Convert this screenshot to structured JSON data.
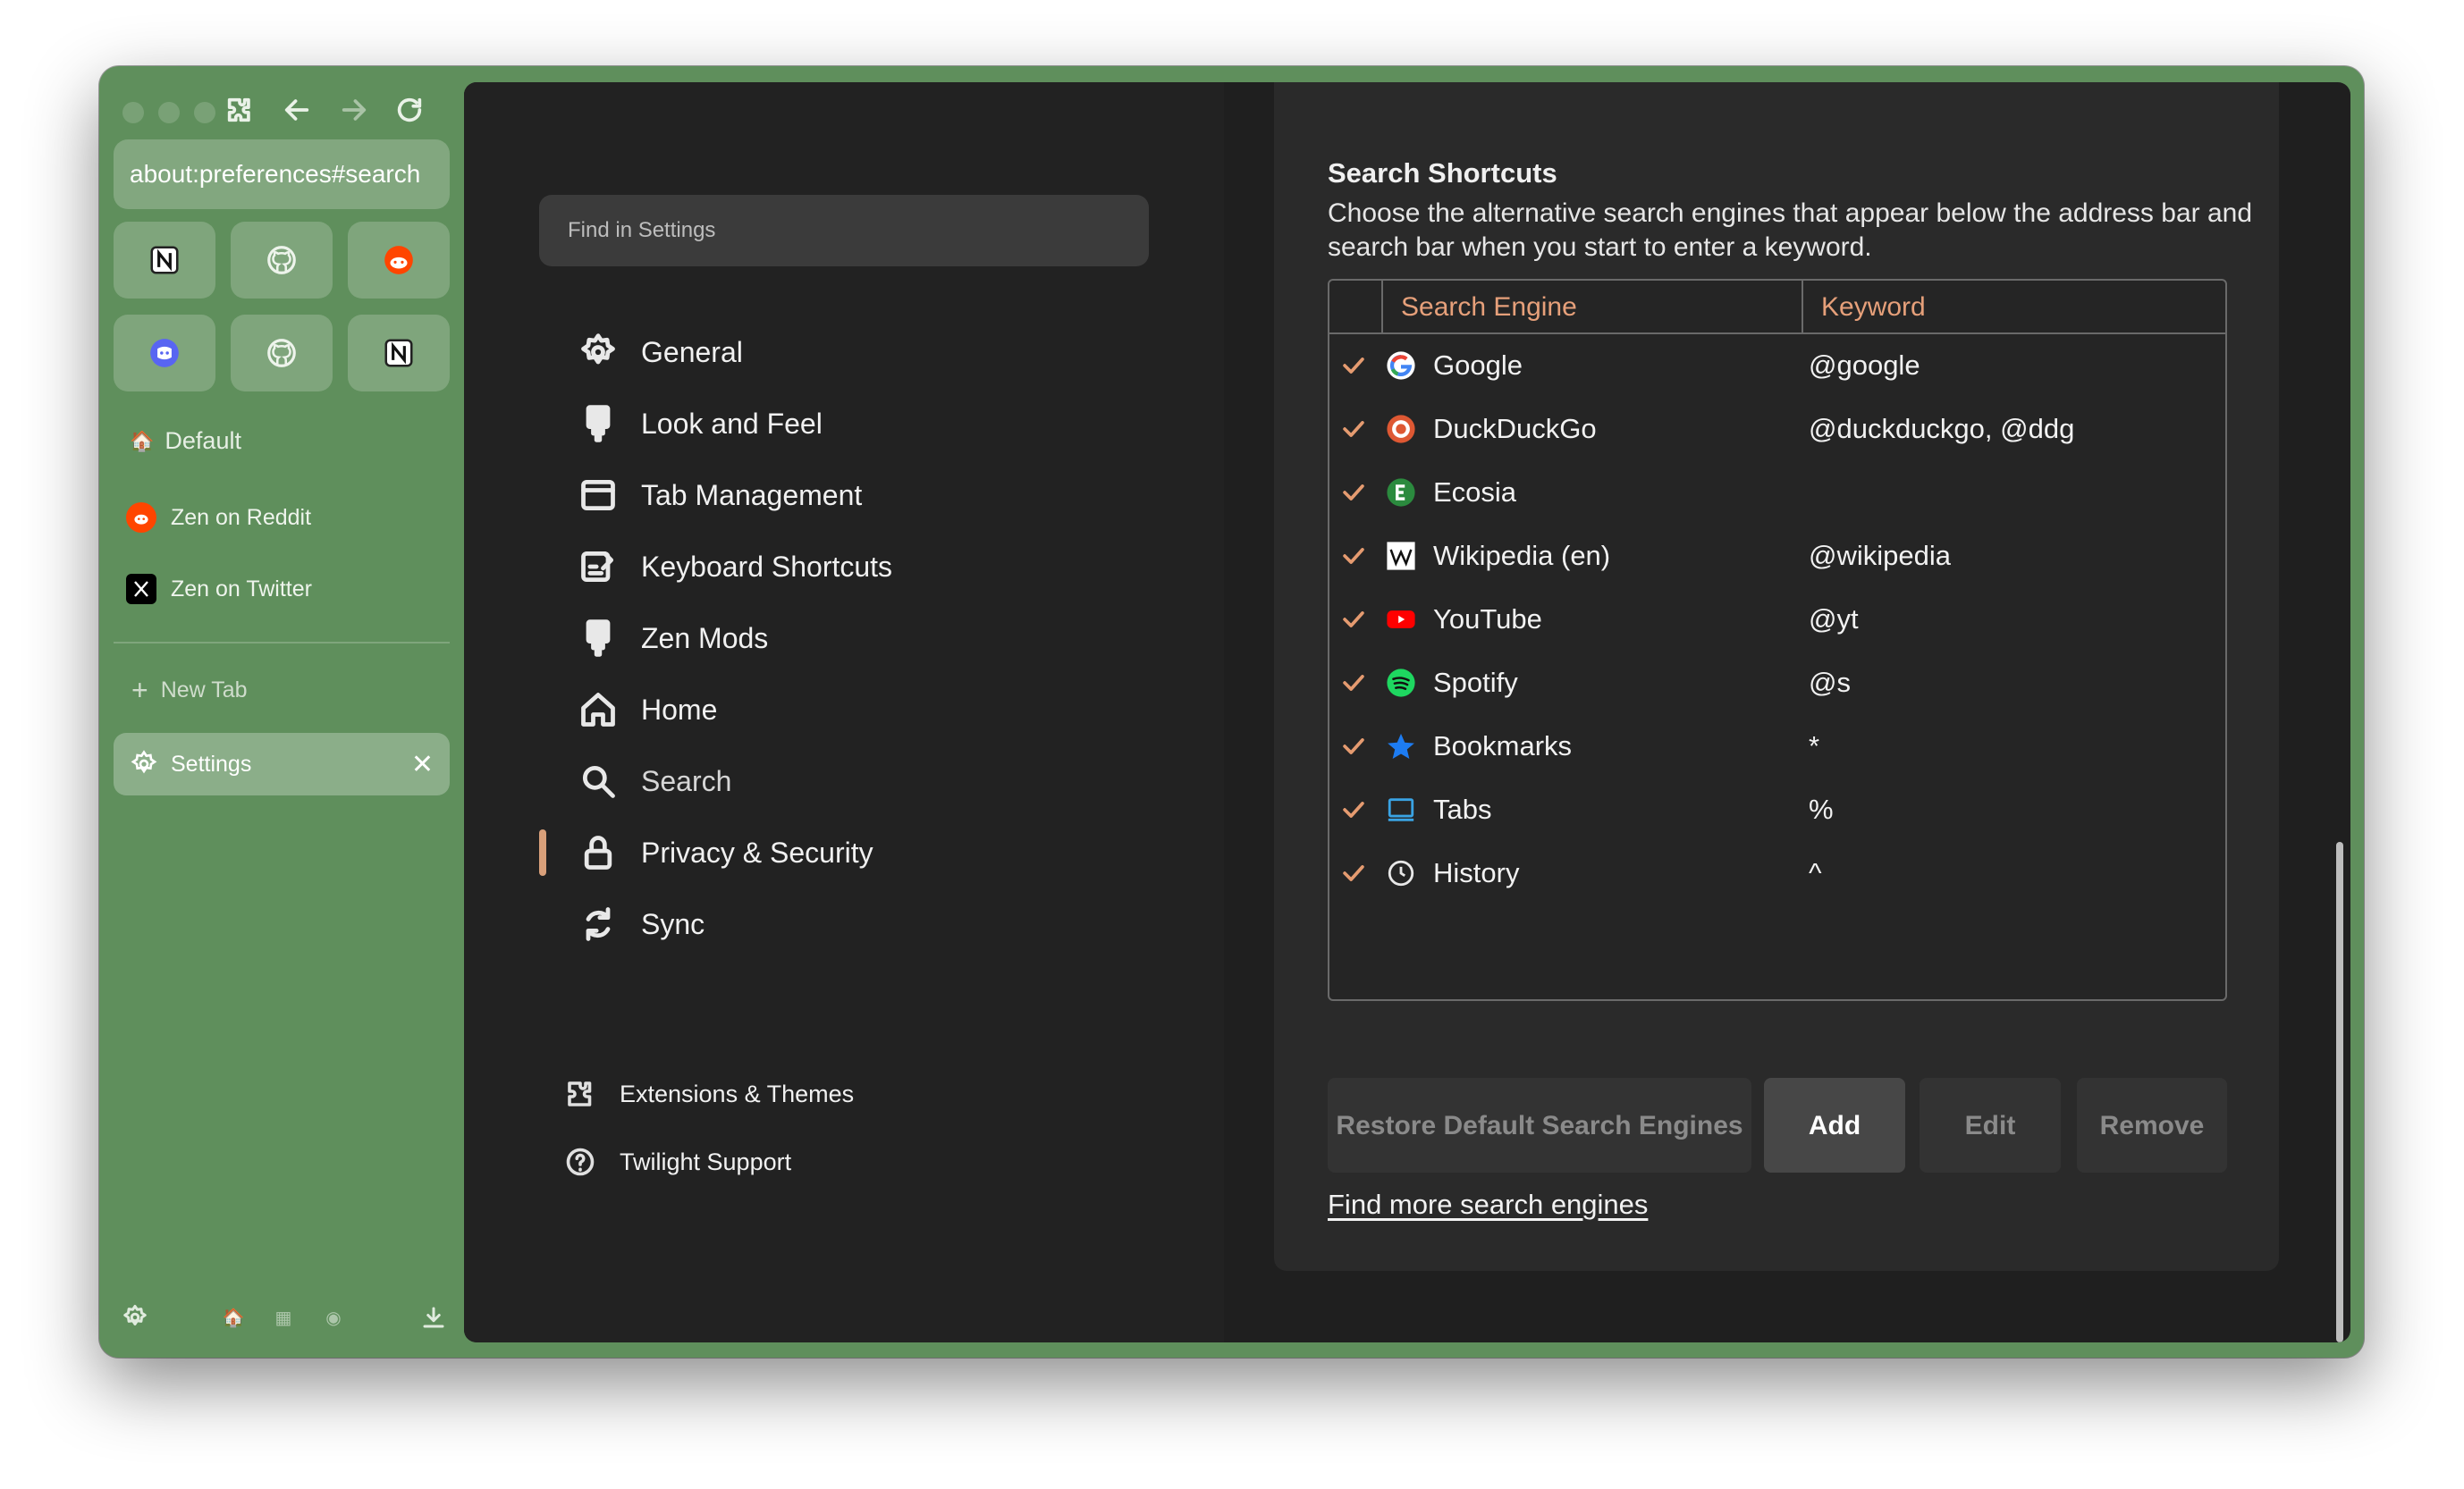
{
  "browser": {
    "url": "about:preferences#search",
    "workspace": "Default",
    "pinned_tabs": [
      {
        "label": "Zen on Reddit",
        "icon": "reddit-icon"
      },
      {
        "label": "Zen on Twitter",
        "icon": "x-twitter-icon"
      }
    ],
    "new_tab_label": "New Tab",
    "active_tab_label": "Settings",
    "essentials_icons": [
      "notion-icon",
      "github-icon",
      "reddit-icon",
      "discord-icon",
      "github-icon",
      "notion-icon"
    ]
  },
  "settings": {
    "search_placeholder": "Find in Settings",
    "categories": [
      {
        "label": "General",
        "icon": "gear-icon"
      },
      {
        "label": "Look and Feel",
        "icon": "brush-icon"
      },
      {
        "label": "Tab Management",
        "icon": "window-icon"
      },
      {
        "label": "Keyboard Shortcuts",
        "icon": "keyboard-icon"
      },
      {
        "label": "Zen Mods",
        "icon": "brush-icon"
      },
      {
        "label": "Home",
        "icon": "home-icon"
      },
      {
        "label": "Search",
        "icon": "search-icon"
      },
      {
        "label": "Privacy & Security",
        "icon": "lock-icon"
      },
      {
        "label": "Sync",
        "icon": "sync-icon"
      }
    ],
    "active_category": "Search",
    "footer_links": [
      {
        "label": "Extensions & Themes",
        "icon": "puzzle-icon"
      },
      {
        "label": "Twilight Support",
        "icon": "help-icon"
      }
    ]
  },
  "search_shortcuts": {
    "title": "Search Shortcuts",
    "description": "Choose the alternative search engines that appear below the address bar and search bar when you start to enter a keyword.",
    "columns": [
      "Search Engine",
      "Keyword"
    ],
    "engines": [
      {
        "name": "Google",
        "keyword": "@google",
        "checked": true,
        "icon": "google-icon"
      },
      {
        "name": "DuckDuckGo",
        "keyword": "@duckduckgo, @ddg",
        "checked": true,
        "icon": "duckduckgo-icon"
      },
      {
        "name": "Ecosia",
        "keyword": "",
        "checked": true,
        "icon": "ecosia-icon"
      },
      {
        "name": "Wikipedia (en)",
        "keyword": "@wikipedia",
        "checked": true,
        "icon": "wikipedia-icon"
      },
      {
        "name": "YouTube",
        "keyword": "@yt",
        "checked": true,
        "icon": "youtube-icon"
      },
      {
        "name": "Spotify",
        "keyword": "@s",
        "checked": true,
        "icon": "spotify-icon"
      },
      {
        "name": "Bookmarks",
        "keyword": "*",
        "checked": true,
        "icon": "star-icon"
      },
      {
        "name": "Tabs",
        "keyword": "%",
        "checked": true,
        "icon": "tabs-icon"
      },
      {
        "name": "History",
        "keyword": "^",
        "checked": true,
        "icon": "clock-icon"
      }
    ],
    "buttons": {
      "restore": "Restore Default Search Engines",
      "add": "Add",
      "edit": "Edit",
      "remove": "Remove"
    },
    "find_more_link": "Find more search engines"
  },
  "colors": {
    "sidebar_bg": "#5f8f5c",
    "accent": "#e59b70",
    "content_bg": "#1f1f1f"
  }
}
